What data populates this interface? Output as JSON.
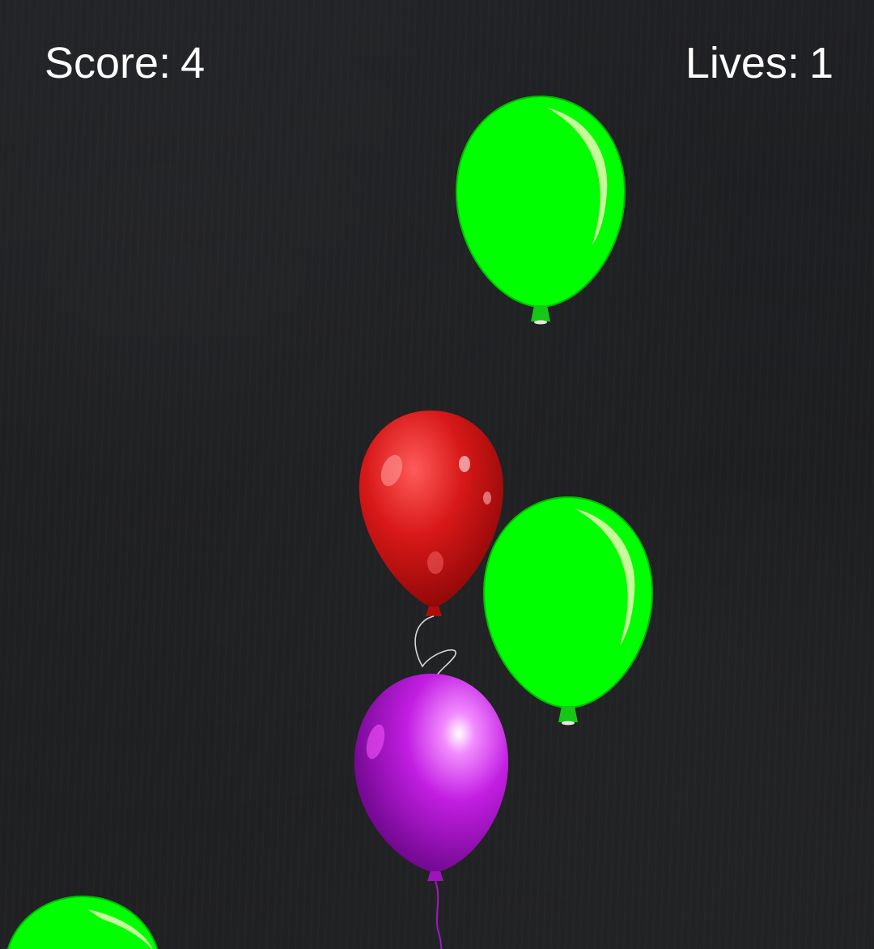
{
  "hud": {
    "score_label": "Score:",
    "score_value": "4",
    "lives_label": "Lives:",
    "lives_value": "1"
  },
  "balloons": [
    {
      "id": "green-1",
      "color": "green",
      "fill": "#00ff00"
    },
    {
      "id": "red-1",
      "color": "red",
      "fill": "#c81414"
    },
    {
      "id": "green-2",
      "color": "green",
      "fill": "#00ff00"
    },
    {
      "id": "purple-1",
      "color": "purple",
      "fill": "#b01ad8"
    },
    {
      "id": "green-3",
      "color": "green",
      "fill": "#00ff00"
    }
  ],
  "colors": {
    "background": "#1e1f21",
    "hud_text": "#ffffff"
  }
}
